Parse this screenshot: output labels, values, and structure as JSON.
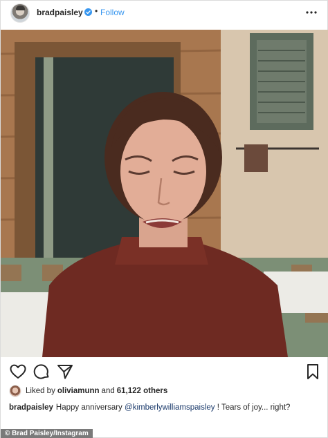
{
  "header": {
    "username": "bradpaisley",
    "separator": "•",
    "follow_label": "Follow",
    "verified_color": "#3897f0",
    "icons": {
      "avatar": "profile-avatar",
      "verified": "verified-badge-icon",
      "more": "more-options-icon"
    }
  },
  "post": {
    "image_subject": "photo",
    "icons": {
      "like": "heart-icon",
      "comment": "comment-bubble-icon",
      "share": "paper-plane-icon",
      "save": "bookmark-icon"
    }
  },
  "likes": {
    "prefix": "Liked by",
    "liker": "oliviamunn",
    "and": "and",
    "count": "61,122 others"
  },
  "caption": {
    "username": "bradpaisley",
    "text_before": "Happy anniversary",
    "mention": "@kimberlywilliamspaisley",
    "text_after": "! Tears of joy... right?"
  },
  "credit": "© Brad Paisley/Instagram",
  "colors": {
    "link": "#3897f0",
    "text": "#262626",
    "mention": "#1b3a6b"
  }
}
